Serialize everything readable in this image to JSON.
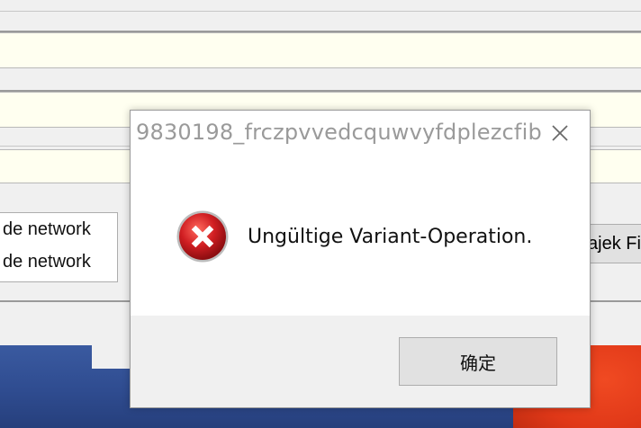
{
  "background_window": {
    "list_items": [
      "de network",
      "de network"
    ],
    "right_button_label": "ajek Fi"
  },
  "dialog": {
    "title": "9830198_frczpvvedcquwvyfdplezcfib",
    "message": "Ungültige Variant-Operation.",
    "ok_label": "确定",
    "icon": "error-icon",
    "close_icon": "close-icon"
  },
  "colors": {
    "error_red": "#c0191f",
    "field_bg": "#fffff0",
    "dialog_bg": "#ffffff",
    "footer_bg": "#f0f0f0"
  }
}
